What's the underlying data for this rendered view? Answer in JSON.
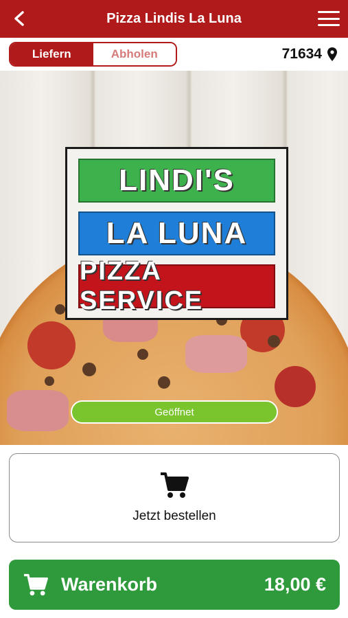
{
  "header": {
    "title": "Pizza Lindis La Luna",
    "back_icon": "chevron-left-icon",
    "menu_icon": "hamburger-menu-icon",
    "color": "#b01a1a"
  },
  "mode_toggle": {
    "options": [
      {
        "label": "Liefern",
        "active": true
      },
      {
        "label": "Abholen",
        "active": false
      }
    ]
  },
  "location": {
    "zip": "71634",
    "icon": "map-pin-icon"
  },
  "logo": {
    "line1": "LINDI'S",
    "line2": "LA LUNA",
    "line3": "PIZZA SERVICE"
  },
  "status": {
    "label": "Geöffnet",
    "color": "#7ac52d"
  },
  "order_card": {
    "icon": "shopping-cart-icon",
    "label": "Jetzt bestellen"
  },
  "cart": {
    "icon": "shopping-cart-icon",
    "label": "Warenkorb",
    "total": "18,00 €",
    "color": "#2f9a3c"
  }
}
